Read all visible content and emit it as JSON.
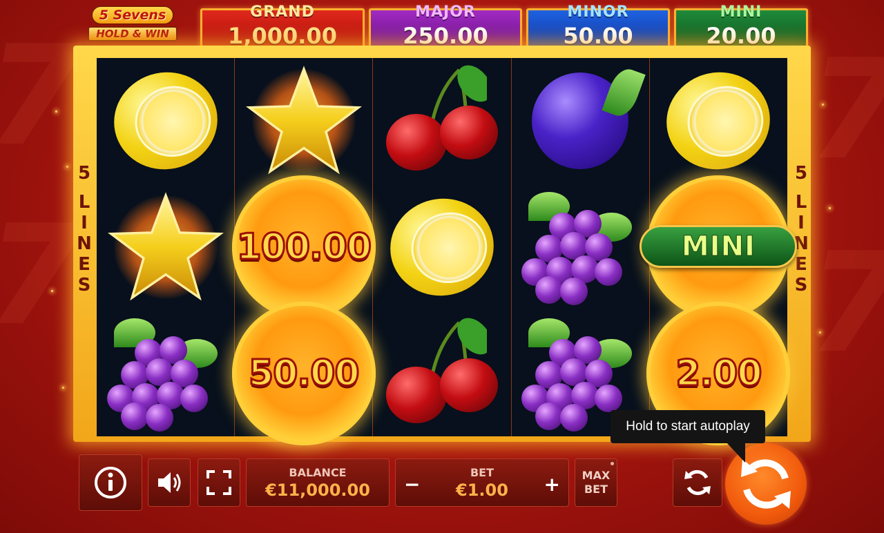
{
  "logo": {
    "line1": "5 Sevens",
    "line2": "HOLD & WIN"
  },
  "jackpots": {
    "grand": {
      "label": "GRAND",
      "value": "1,000.00"
    },
    "major": {
      "label": "MAJOR",
      "value": "250.00"
    },
    "minor": {
      "label": "MINOR",
      "value": "50.00"
    },
    "mini": {
      "label": "MINI",
      "value": "20.00"
    }
  },
  "side_lines": {
    "count": "5",
    "word": [
      "L",
      "I",
      "N",
      "E",
      "S"
    ]
  },
  "reels": [
    [
      "lemon",
      "star",
      "grapes"
    ],
    [
      "star",
      "coin",
      "coin"
    ],
    [
      "cherry",
      "lemon",
      "cherry"
    ],
    [
      "plum",
      "grapes",
      "grapes"
    ],
    [
      "lemon",
      "coin",
      "coin"
    ]
  ],
  "coins": {
    "r2_row2": "100.00",
    "r2_row3": "50.00",
    "r5_row2": "MINI",
    "r5_row3": "2.00"
  },
  "controls": {
    "balance_label": "BALANCE",
    "balance_value": "€11,000.00",
    "bet_label": "BET",
    "bet_value": "€1.00",
    "bet_minus": "−",
    "bet_plus": "+",
    "maxbet_line1": "MAX",
    "maxbet_line2": "BET"
  },
  "tooltip": "Hold to start autoplay",
  "icons": [
    "info-icon",
    "sound-icon",
    "fullscreen-icon",
    "autoplay-icon",
    "spin-icon"
  ],
  "colors": {
    "background": "#a3140e",
    "frame": "#f2a619",
    "spin": "#f15a0c"
  }
}
